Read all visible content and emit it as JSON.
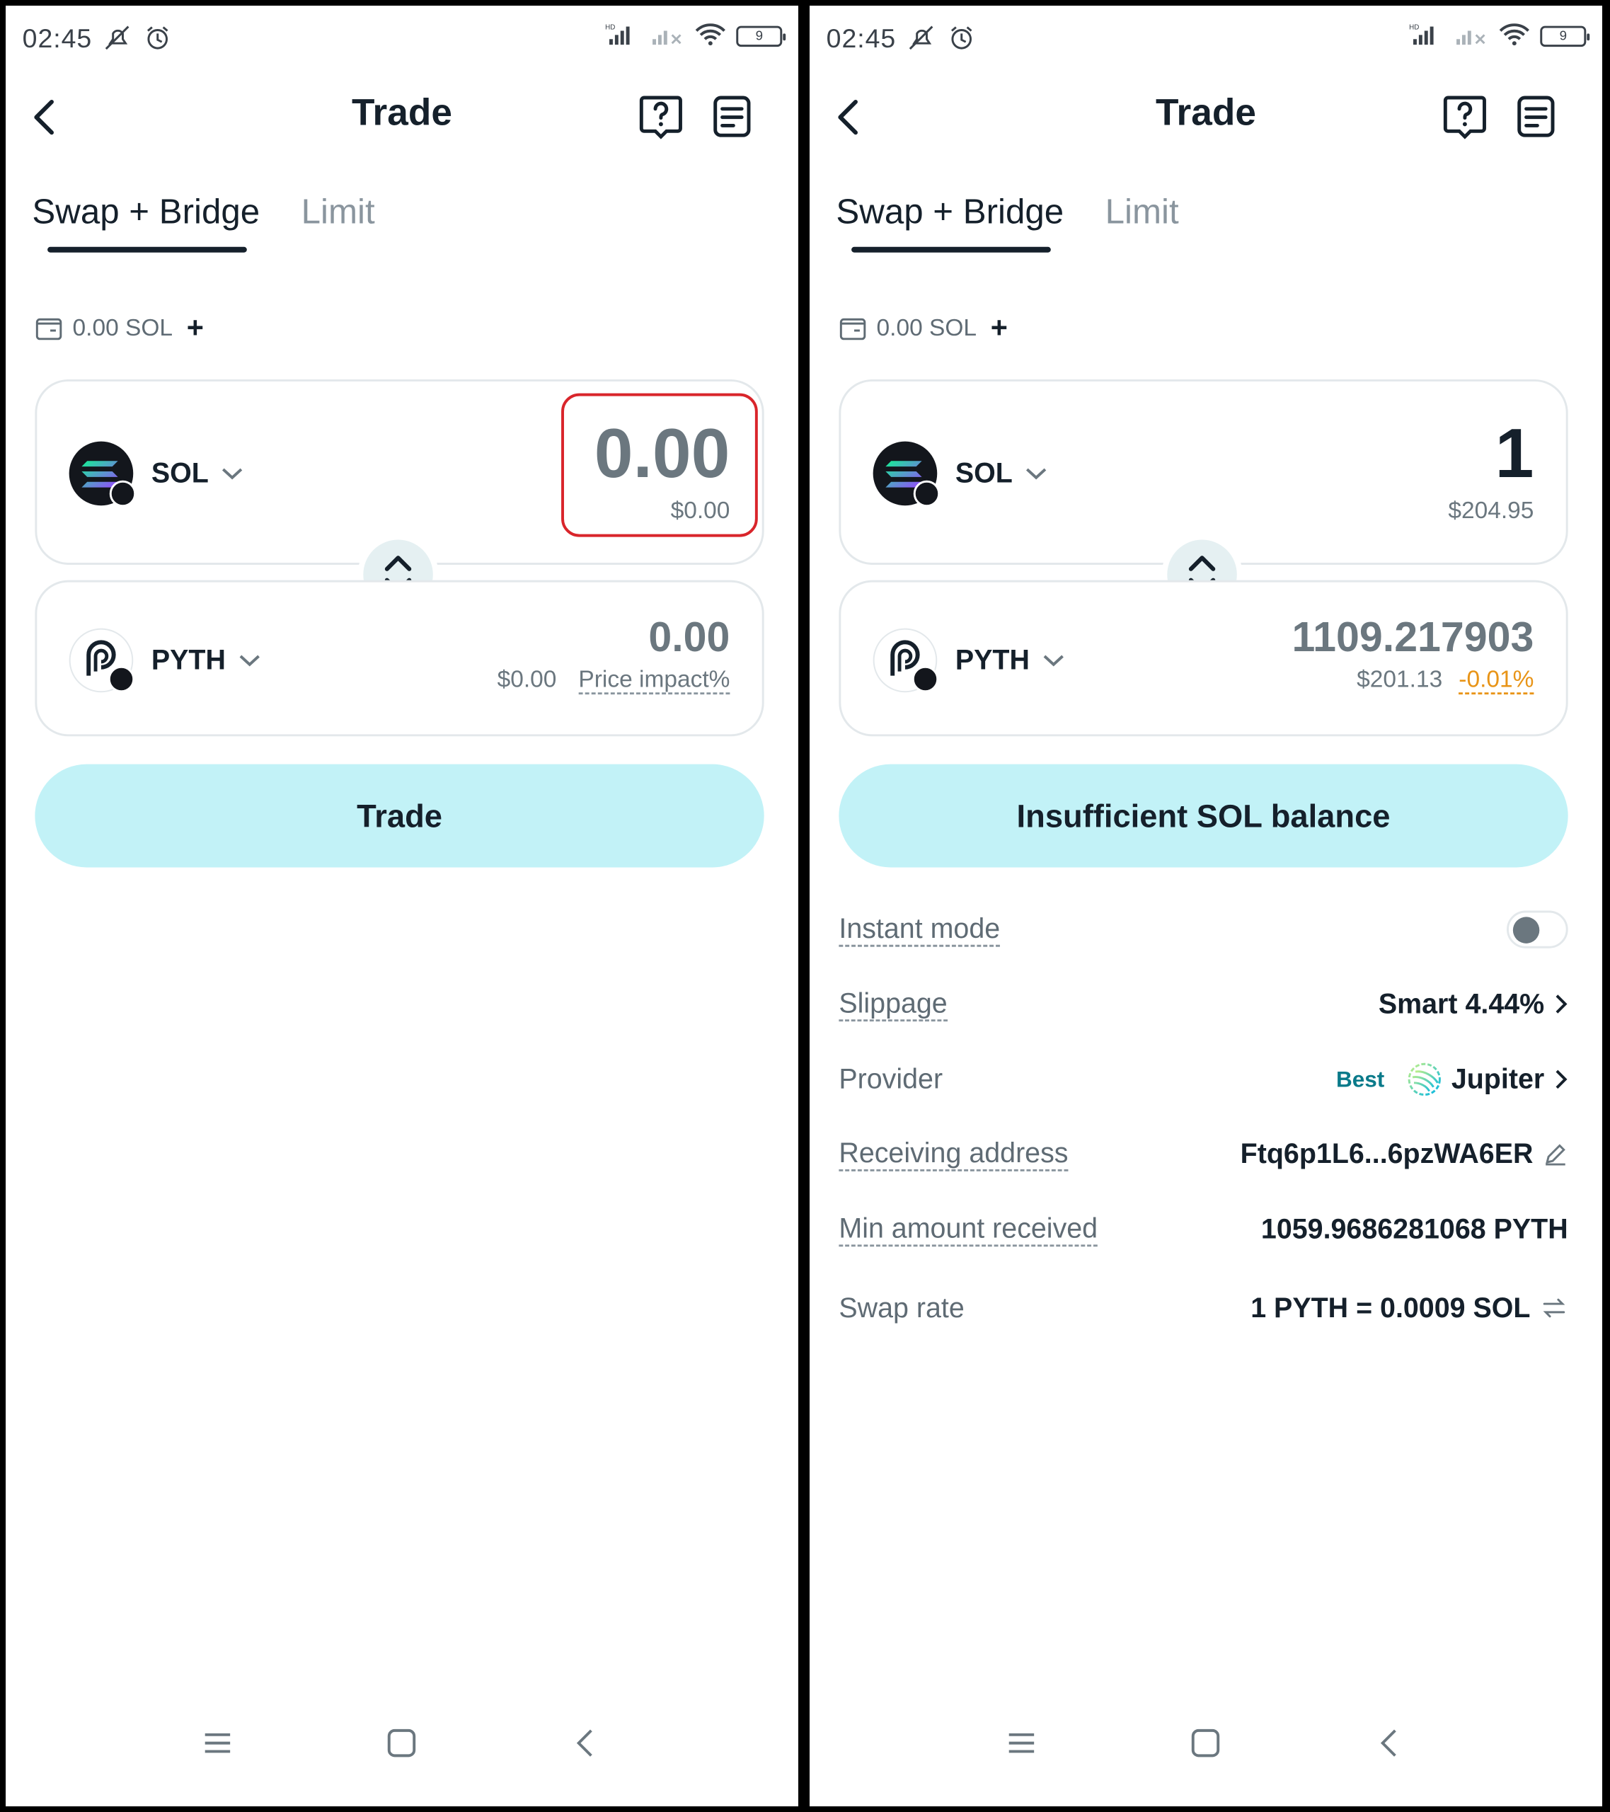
{
  "panels": [
    {
      "status": {
        "time": "02:45",
        "battery": "9"
      },
      "title": "Trade",
      "tabs": [
        {
          "label": "Swap + Bridge",
          "active": true
        },
        {
          "label": "Limit",
          "active": false
        }
      ],
      "balance": "0.00 SOL",
      "from": {
        "token": "SOL",
        "amount": "0.00",
        "usd": "$0.00",
        "icon": "solana-logo-icon"
      },
      "to": {
        "token": "PYTH",
        "amount": "0.00",
        "usd": "$0.00",
        "impact": "Price impact%",
        "icon": "pyth-logo-icon"
      },
      "button": "Trade",
      "highlight": true
    },
    {
      "status": {
        "time": "02:45",
        "battery": "9"
      },
      "title": "Trade",
      "tabs": [
        {
          "label": "Swap + Bridge",
          "active": true
        },
        {
          "label": "Limit",
          "active": false
        }
      ],
      "balance": "0.00 SOL",
      "from": {
        "token": "SOL",
        "amount": "1",
        "usd": "$204.95",
        "icon": "solana-logo-icon"
      },
      "to": {
        "token": "PYTH",
        "amount": "1109.217903",
        "usd": "$201.13",
        "impact": "-0.01%",
        "icon": "pyth-logo-icon"
      },
      "button": "Insufficient SOL balance",
      "details": {
        "instant_mode": {
          "label": "Instant mode",
          "enabled": false
        },
        "slippage": {
          "label": "Slippage",
          "value": "Smart 4.44%"
        },
        "provider": {
          "label": "Provider",
          "badge": "Best",
          "value": "Jupiter"
        },
        "receiving_address": {
          "label": "Receiving address",
          "value": "Ftq6p1L6...6pzWA6ER"
        },
        "min_received": {
          "label": "Min amount received",
          "value": "1059.9686281068 PYTH"
        },
        "swap_rate": {
          "label": "Swap rate",
          "value": "1 PYTH = 0.0009 SOL"
        }
      }
    }
  ],
  "colors": {
    "accent_button": "#c2f2f7",
    "highlight_box": "#d9252b",
    "negative_impact": "#e89417",
    "text_dark": "#15202b"
  }
}
